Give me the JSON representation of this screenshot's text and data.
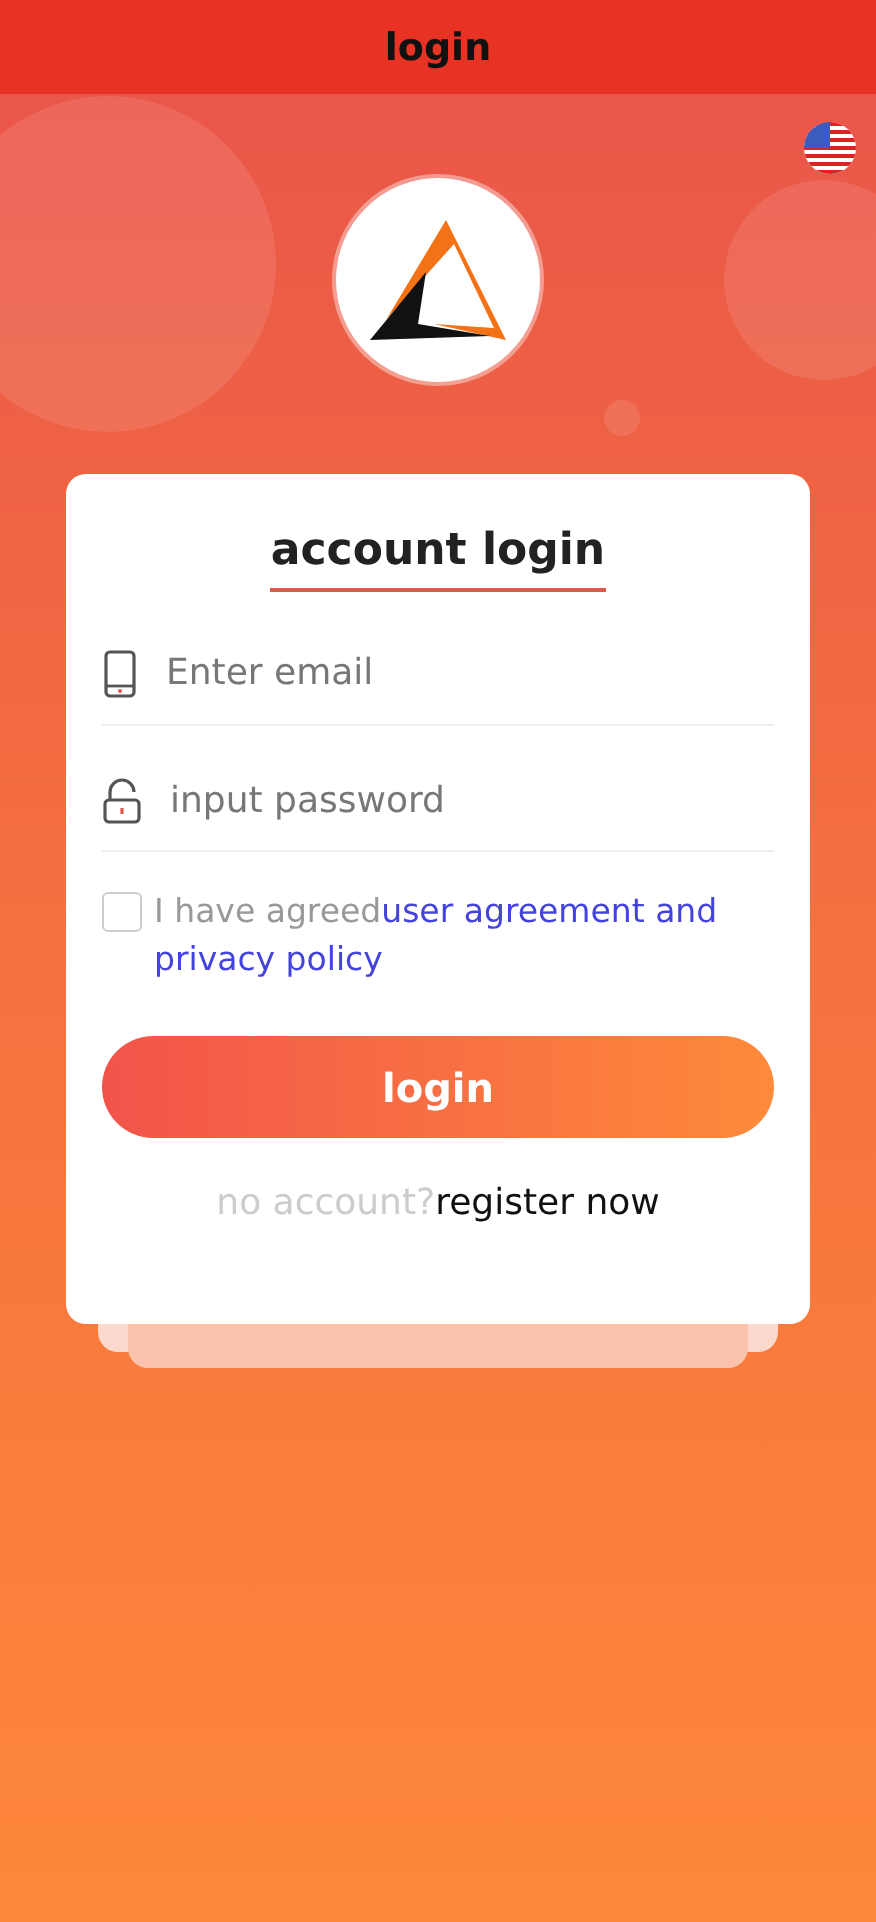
{
  "header": {
    "title": "login"
  },
  "form": {
    "title": "account login",
    "fields": [
      {
        "kind": "email",
        "placeholder": "Enter email"
      },
      {
        "kind": "password",
        "placeholder": "input password"
      }
    ],
    "agreement": {
      "checked": false,
      "text": "I have agreed",
      "link": "user agreement and privacy policy"
    },
    "submit": "login",
    "footer": {
      "text": "no account?",
      "link": "register now"
    }
  }
}
